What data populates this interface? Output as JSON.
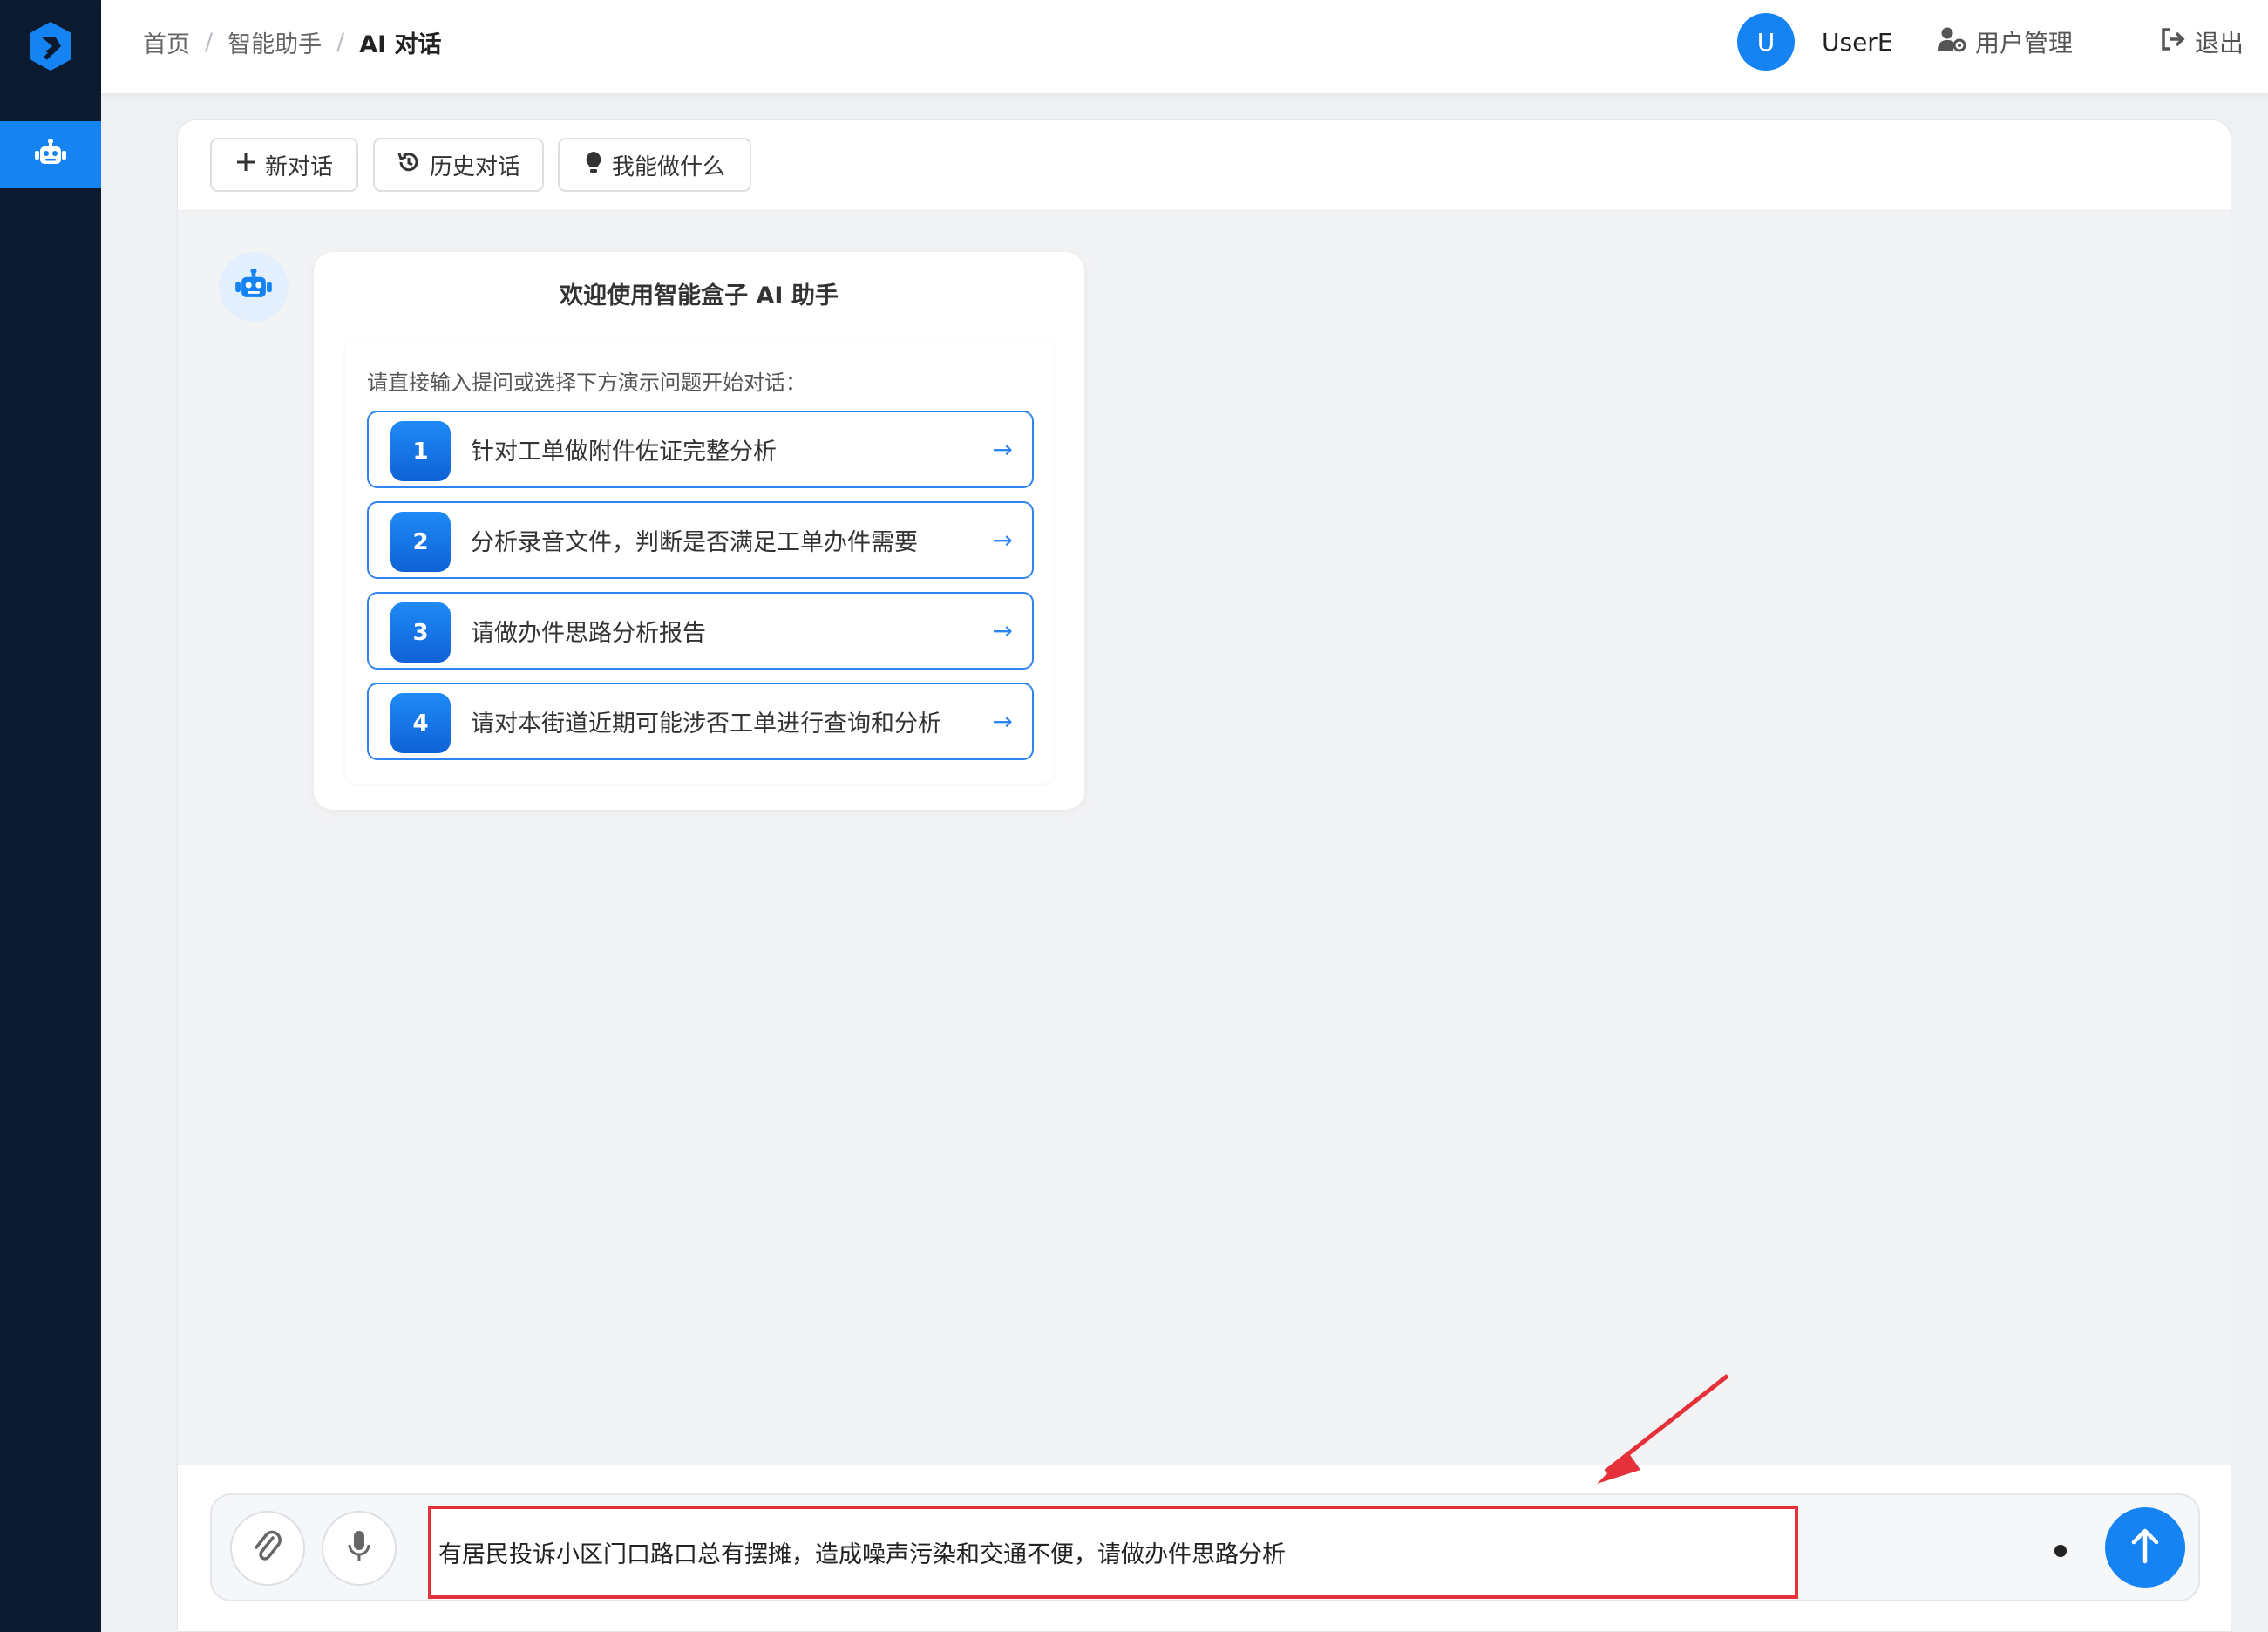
{
  "breadcrumb": [
    "首页",
    "智能助手",
    "AI 对话"
  ],
  "user": {
    "avatar_letter": "U",
    "name": "UserE"
  },
  "header": {
    "user_management": "用户管理",
    "logout": "退出"
  },
  "toolbar": {
    "new_chat": "新对话",
    "history": "历史对话",
    "capabilities": "我能做什么"
  },
  "welcome": {
    "title": "欢迎使用智能盒子 AI 助手",
    "prompt": "请直接输入提问或选择下方演示问题开始对话：",
    "suggestions": [
      {
        "num": "1",
        "text": "针对工单做附件佐证完整分析",
        "arrow": "→"
      },
      {
        "num": "2",
        "text": "分析录音文件，判断是否满足工单办件需要",
        "arrow": "→"
      },
      {
        "num": "3",
        "text": "请做办件思路分析报告",
        "arrow": "→"
      },
      {
        "num": "4",
        "text": "请对本街道近期可能涉否工单进行查询和分析",
        "arrow": "→"
      }
    ]
  },
  "input": {
    "value": "有居民投诉小区门口路口总有摆摊，造成噪声污染和交通不便，请做办件思路分析"
  },
  "colors": {
    "accent": "#1683f2",
    "sidebar": "#0b1a2e",
    "highlight": "#e5323a"
  },
  "icons": {
    "logo": "app-logo-icon",
    "nav": "robot-icon",
    "user_mgmt": "user-gear-icon",
    "logout": "logout-icon",
    "new_chat": "plus-icon",
    "history": "history-icon",
    "capabilities": "lightbulb-icon",
    "attach": "paperclip-icon",
    "mic": "microphone-icon",
    "send": "arrow-up-icon"
  }
}
